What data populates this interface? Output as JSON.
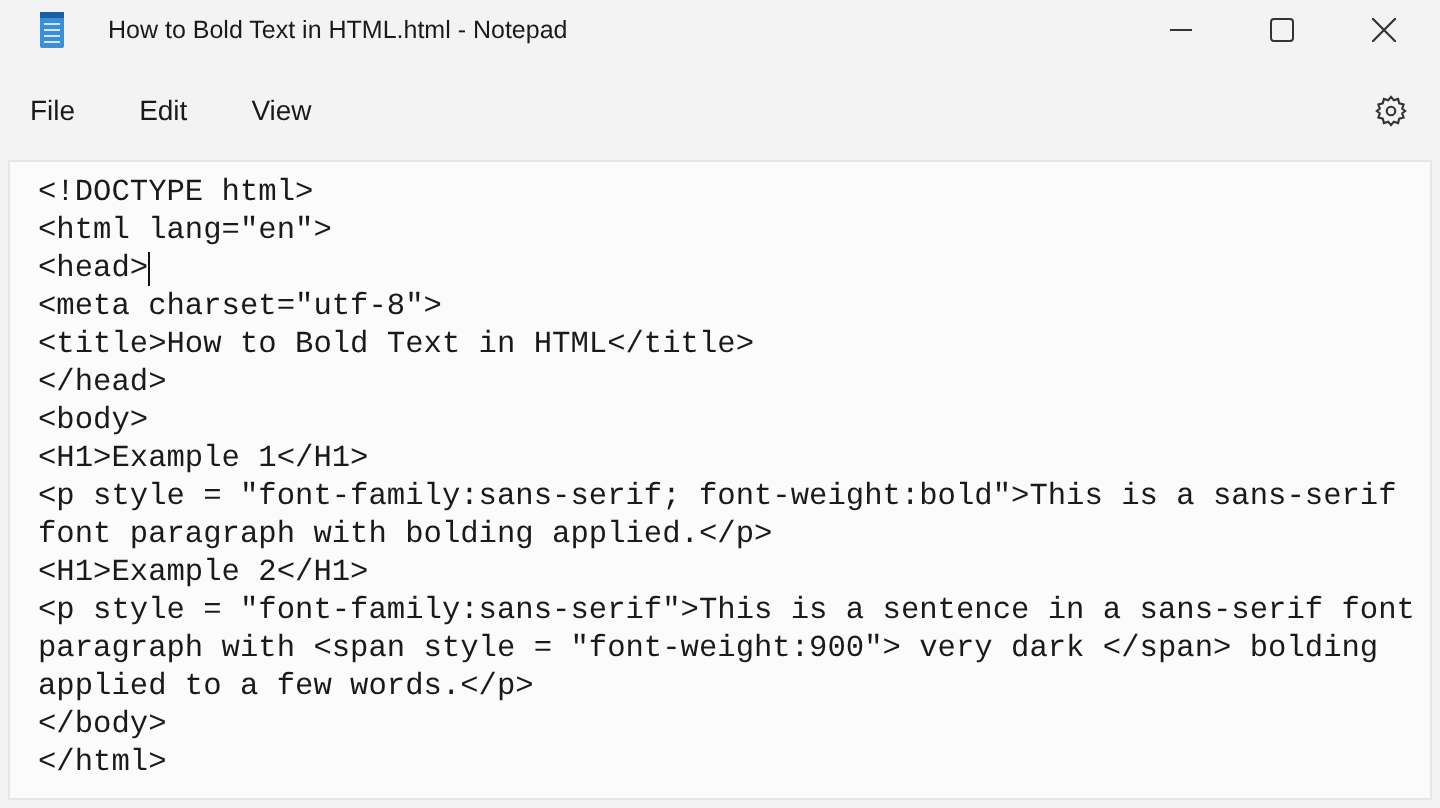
{
  "window": {
    "title": "How to Bold Text in HTML.html - Notepad"
  },
  "menu": [
    {
      "label": "File"
    },
    {
      "label": "Edit"
    },
    {
      "label": "View"
    }
  ],
  "editor": {
    "lines": [
      {
        "text": "<!DOCTYPE html>",
        "cursor": false
      },
      {
        "text": "<html lang=\"en\">",
        "cursor": false
      },
      {
        "text": "<head>",
        "cursor": true
      },
      {
        "text": "<meta charset=\"utf-8\">",
        "cursor": false
      },
      {
        "text": "<title>How to Bold Text in HTML</title>",
        "cursor": false
      },
      {
        "text": "</head>",
        "cursor": false
      },
      {
        "text": "<body>",
        "cursor": false
      },
      {
        "text": "<H1>Example 1</H1>",
        "cursor": false
      },
      {
        "text": "<p style = \"font-family:sans-serif; font-weight:bold\">This is a sans-serif",
        "cursor": false
      },
      {
        "text": "font paragraph with bolding applied.</p>",
        "cursor": false
      },
      {
        "text": "<H1>Example 2</H1>",
        "cursor": false
      },
      {
        "text": "<p style = \"font-family:sans-serif\">This is a sentence in a sans-serif font",
        "cursor": false
      },
      {
        "text": "paragraph with <span style = \"font-weight:900\"> very dark </span> bolding",
        "cursor": false
      },
      {
        "text": "applied to a few words.</p>",
        "cursor": false
      },
      {
        "text": "</body>",
        "cursor": false
      },
      {
        "text": "</html>",
        "cursor": false
      }
    ]
  }
}
